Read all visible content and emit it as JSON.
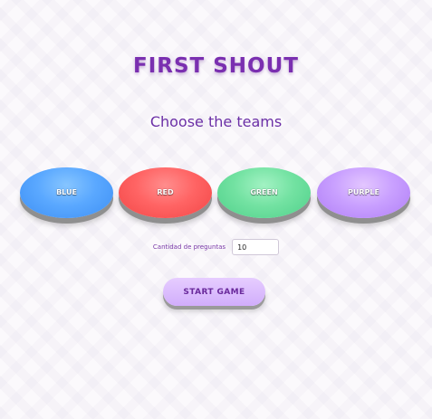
{
  "title": "FIRST SHOUT",
  "subtitle": "Choose the teams",
  "teams": [
    {
      "label": "BLUE",
      "color": "#5aa8ff"
    },
    {
      "label": "RED",
      "color": "#ff6464"
    },
    {
      "label": "GREEN",
      "color": "#73e2a2"
    },
    {
      "label": "PURPLE",
      "color": "#c9a0ff"
    }
  ],
  "questions": {
    "label": "Cantidad de preguntas",
    "value": "10"
  },
  "start_button": {
    "label": "START GAME"
  },
  "colors": {
    "title": "#7a2fb0",
    "accent": "#6b2fa6",
    "background": "#fbf9fc"
  }
}
